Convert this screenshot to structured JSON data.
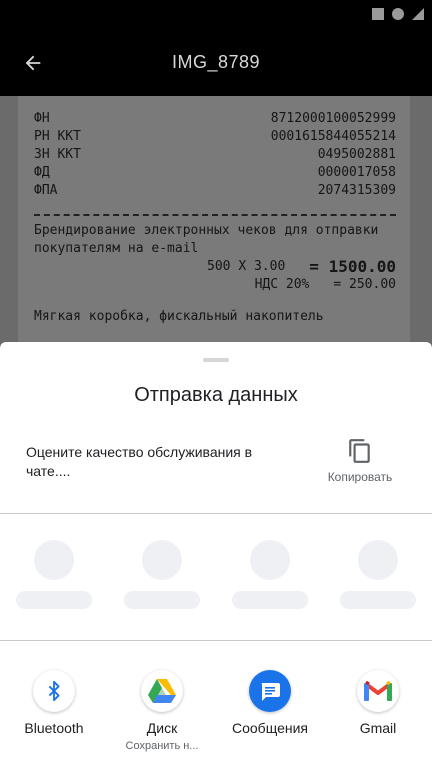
{
  "status_bar": {
    "icons": [
      "square-icon",
      "circle-icon",
      "triangle-icon"
    ]
  },
  "app_bar": {
    "title": "IMG_8789",
    "back_icon": "back-arrow-icon"
  },
  "photo": {
    "lines": [
      {
        "label": "ФН",
        "value": "8712000100052999"
      },
      {
        "label": "РН ККТ",
        "value": "0001615844055214"
      },
      {
        "label": "ЗН ККТ",
        "value": "0495002881"
      },
      {
        "label": "ФД",
        "value": "0000017058"
      },
      {
        "label": "ФПА",
        "value": "2074315309"
      }
    ],
    "item_line1": "Брендирование электронных чеков для отправки",
    "item_line2": "покупателям на e-mail",
    "price_qty": "500 X 3.00",
    "price_total": "= 1500.00",
    "tax_label": "НДС 20%",
    "tax_value": "= 250.00",
    "tail": "Мягкая коробка, фискальный накопитель"
  },
  "share_sheet": {
    "title": "Отправка данных",
    "preview_text": "Оцените качество обслуживания в чате....",
    "copy_label": "Копировать",
    "apps": [
      {
        "label": "Bluetooth",
        "sub": "",
        "icon": "bluetooth-icon"
      },
      {
        "label": "Диск",
        "sub": "Сохранить н...",
        "icon": "google-drive-icon"
      },
      {
        "label": "Сообщения",
        "sub": "",
        "icon": "messages-icon"
      },
      {
        "label": "Gmail",
        "sub": "",
        "icon": "gmail-icon"
      }
    ]
  },
  "colors": {
    "accent_blue": "#1a73e8",
    "sheet_bg": "#ffffff",
    "app_bar_bg": "#000000"
  }
}
